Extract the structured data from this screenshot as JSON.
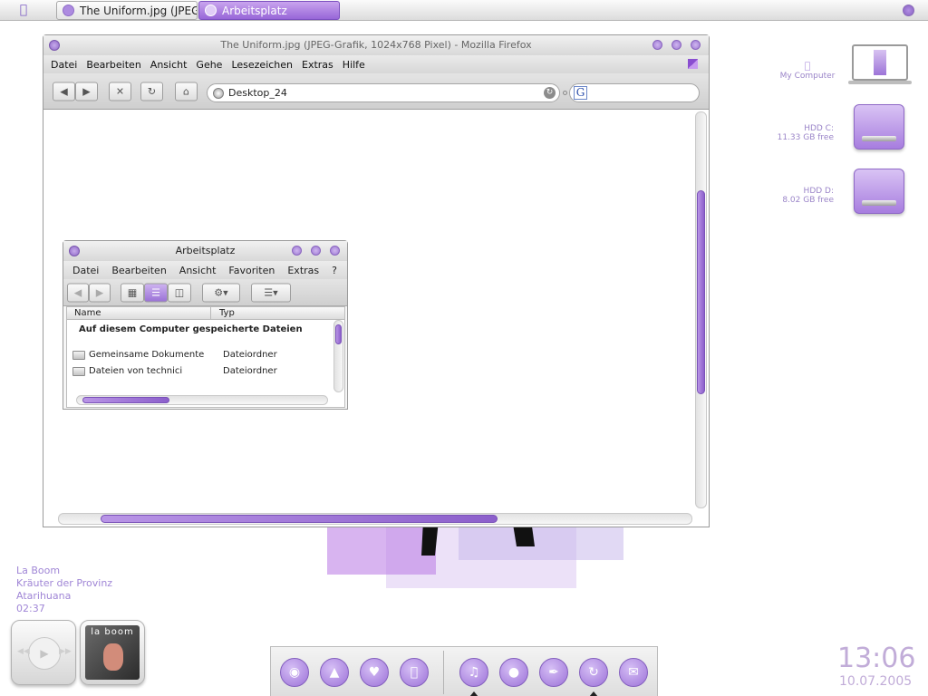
{
  "taskbar": {
    "apple_glyph": "",
    "tasks": [
      {
        "label": "The Uniform.jpg (JPEG..."
      },
      {
        "label": "Arbeitsplatz"
      }
    ]
  },
  "firefox": {
    "title": "The Uniform.jpg (JPEG-Grafik, 1024x768 Pixel) - Mozilla Firefox",
    "menu": [
      "Datei",
      "Bearbeiten",
      "Ansicht",
      "Gehe",
      "Lesezeichen",
      "Extras",
      "Hilfe"
    ],
    "url": "Desktop_24",
    "search_placeholder": "",
    "search_engine_letter": "G"
  },
  "explorer": {
    "title": "Arbeitsplatz",
    "menu": [
      "Datei",
      "Bearbeiten",
      "Ansicht",
      "Favoriten",
      "Extras",
      "?"
    ],
    "columns": [
      "Name",
      "Typ"
    ],
    "group_header": "Auf diesem Computer gespeicherte Dateien",
    "rows": [
      {
        "name": "Gemeinsame Dokumente",
        "type": "Dateiordner"
      },
      {
        "name": "Dateien von technici",
        "type": "Dateiordner"
      }
    ]
  },
  "desktop": {
    "my_computer": "My Computer",
    "hdd_c_name": "HDD C:",
    "hdd_c_free": "11.33 GB free",
    "hdd_d_name": "HDD D:",
    "hdd_d_free": "8.02 GB free"
  },
  "player": {
    "track": "La Boom",
    "album": "Kräuter der Provinz",
    "artist": "Atarihuana",
    "time": "02:37",
    "cover_text": "la boom"
  },
  "clock": {
    "time": "13:06",
    "date": "10.07.2005"
  },
  "dock": {
    "items": [
      "browser-icon",
      "download-icon",
      "heart-icon",
      "apple-icon",
      "music-icon",
      "chat-icon",
      "pen-icon",
      "refresh-icon",
      "mail-icon"
    ]
  },
  "colors": {
    "accent": "#9b6fd6",
    "accent_light": "#d9c3f4",
    "text_purple": "#a086d6"
  }
}
